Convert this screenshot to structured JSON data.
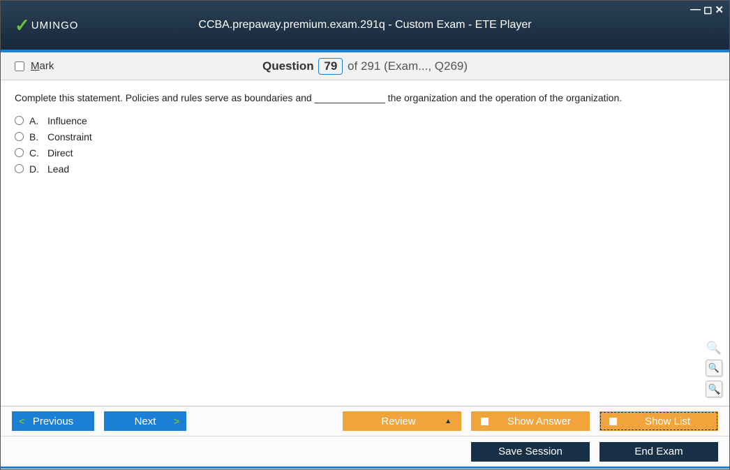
{
  "window": {
    "logo_text": "UMINGO"
  },
  "header": {
    "title": "CCBA.prepaway.premium.exam.291q - Custom Exam - ETE Player"
  },
  "infobar": {
    "mark_label": "Mark",
    "question_label": "Question",
    "current_number": "79",
    "of_text": "of 291 (Exam..., Q269)"
  },
  "question": {
    "text": "Complete this statement. Policies and rules serve as boundaries and _____________ the organization and the operation of the organization.",
    "answers": [
      {
        "letter": "A.",
        "text": "Influence"
      },
      {
        "letter": "B.",
        "text": "Constraint"
      },
      {
        "letter": "C.",
        "text": "Direct"
      },
      {
        "letter": "D.",
        "text": "Lead"
      }
    ]
  },
  "footer": {
    "previous": "Previous",
    "next": "Next",
    "review": "Review",
    "show_answer": "Show Answer",
    "show_list": "Show List",
    "save_session": "Save Session",
    "end_exam": "End Exam"
  }
}
